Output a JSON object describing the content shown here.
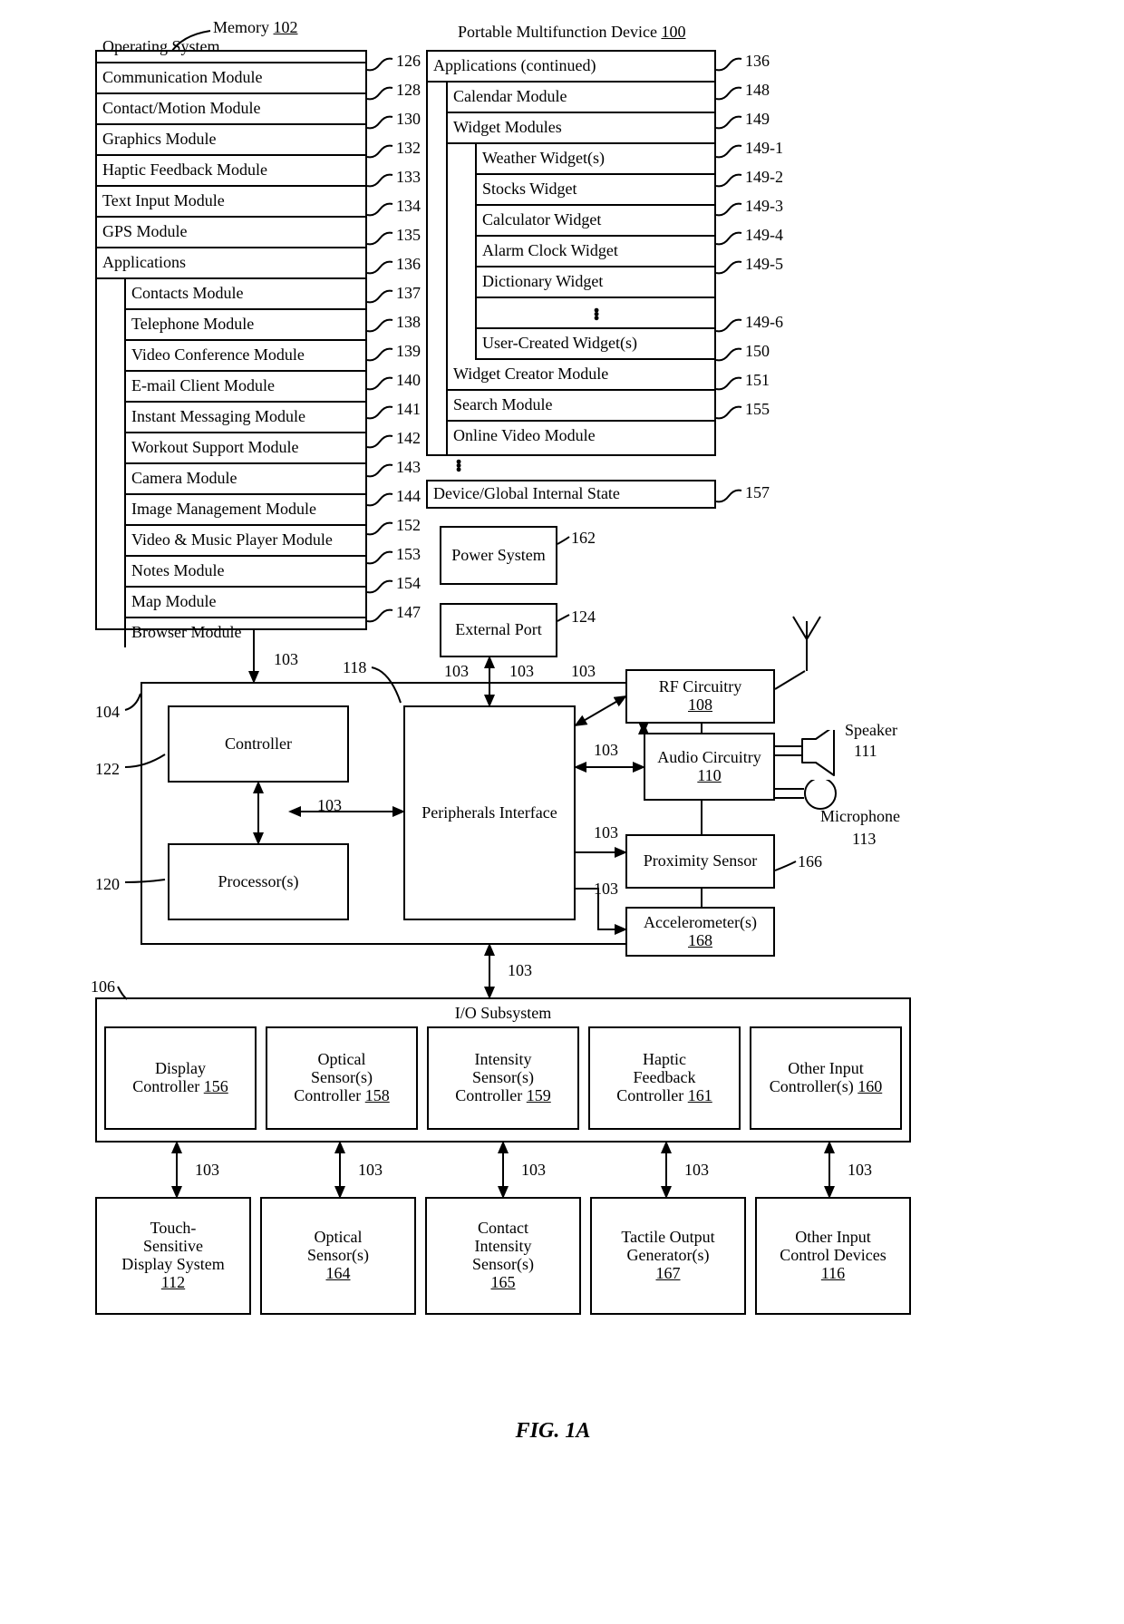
{
  "headers": {
    "memory": "Memory",
    "memory_ref": "102",
    "device": "Portable Multifunction Device",
    "device_ref": "100"
  },
  "left_rows": [
    {
      "label": "Operating System",
      "ref": "126"
    },
    {
      "label": "Communication Module",
      "ref": "128"
    },
    {
      "label": "Contact/Motion Module",
      "ref": "130"
    },
    {
      "label": "Graphics Module",
      "ref": "132"
    },
    {
      "label": "Haptic Feedback Module",
      "ref": "133"
    },
    {
      "label": "Text Input Module",
      "ref": "134"
    },
    {
      "label": "GPS Module",
      "ref": "135"
    },
    {
      "label": "Applications",
      "ref": "136"
    }
  ],
  "left_apps": [
    {
      "label": "Contacts Module",
      "ref": "137"
    },
    {
      "label": "Telephone Module",
      "ref": "138"
    },
    {
      "label": "Video Conference Module",
      "ref": "139"
    },
    {
      "label": "E-mail Client Module",
      "ref": "140"
    },
    {
      "label": "Instant Messaging Module",
      "ref": "141"
    },
    {
      "label": "Workout Support Module",
      "ref": "142"
    },
    {
      "label": "Camera Module",
      "ref": "143"
    },
    {
      "label": "Image Management Module",
      "ref": "144"
    },
    {
      "label": "Video & Music Player Module",
      "ref": "152"
    },
    {
      "label": "Notes Module",
      "ref": "153"
    },
    {
      "label": "Map Module",
      "ref": "154"
    },
    {
      "label": "Browser Module",
      "ref": "147"
    }
  ],
  "right_header": {
    "label": "Applications (continued)",
    "ref": "136"
  },
  "right_sub": [
    {
      "label": "Calendar Module",
      "ref": "148"
    },
    {
      "label": "Widget Modules",
      "ref": "149"
    }
  ],
  "widgets": [
    {
      "label": "Weather Widget(s)",
      "ref": "149-1"
    },
    {
      "label": "Stocks Widget",
      "ref": "149-2"
    },
    {
      "label": "Calculator Widget",
      "ref": "149-3"
    },
    {
      "label": "Alarm Clock Widget",
      "ref": "149-4"
    },
    {
      "label": "Dictionary Widget",
      "ref": "149-5"
    }
  ],
  "widget_last": {
    "label": "User-Created Widget(s)",
    "ref": "149-6"
  },
  "right_after_widgets": [
    {
      "label": "Widget Creator Module",
      "ref": "150"
    },
    {
      "label": "Search Module",
      "ref": "151"
    },
    {
      "label": "Online Video Module",
      "ref": "155"
    }
  ],
  "dgis": {
    "label": "Device/Global Internal State",
    "ref": "157"
  },
  "mid": {
    "controller": "Controller",
    "processors": "Processor(s)",
    "periph": "Peripherals Interface",
    "power": "Power System",
    "power_ref": "162",
    "ext": "External Port",
    "ext_ref": "124",
    "rf": "RF Circuitry",
    "rf_ref": "108",
    "audio": "Audio Circuitry",
    "audio_ref": "110",
    "prox": "Proximity Sensor",
    "prox_ref": "166",
    "accel": "Accelerometer(s)",
    "accel_ref": "168",
    "speaker": "Speaker",
    "speaker_ref": "111",
    "mic": "Microphone",
    "mic_ref": "113",
    "bus_ref": "103",
    "frame_left_ref": "104",
    "ctrl_ref": "122",
    "proc_ref": "120",
    "periph_ref": "118"
  },
  "io": {
    "title": "I/O Subsystem",
    "title_ref": "106",
    "items": [
      {
        "label1": "Display",
        "label2": "Controller",
        "ref": "156"
      },
      {
        "label1": "Optical",
        "label2": "Sensor(s)",
        "label3": "Controller",
        "ref": "158"
      },
      {
        "label1": "Intensity",
        "label2": "Sensor(s)",
        "label3": "Controller",
        "ref": "159"
      },
      {
        "label1": "Haptic",
        "label2": "Feedback",
        "label3": "Controller",
        "ref": "161"
      },
      {
        "label1": "Other Input",
        "label2": "Controller(s)",
        "ref": "160"
      }
    ]
  },
  "bottom": [
    {
      "label": "Touch-\nSensitive\nDisplay System",
      "ref": "112"
    },
    {
      "label": "Optical\nSensor(s)",
      "ref": "164"
    },
    {
      "label": "Contact\nIntensity\nSensor(s)",
      "ref": "165"
    },
    {
      "label": "Tactile Output\nGenerator(s)",
      "ref": "167"
    },
    {
      "label": "Other Input\nControl Devices",
      "ref": "116"
    }
  ],
  "figure_caption": "FIG. 1A"
}
